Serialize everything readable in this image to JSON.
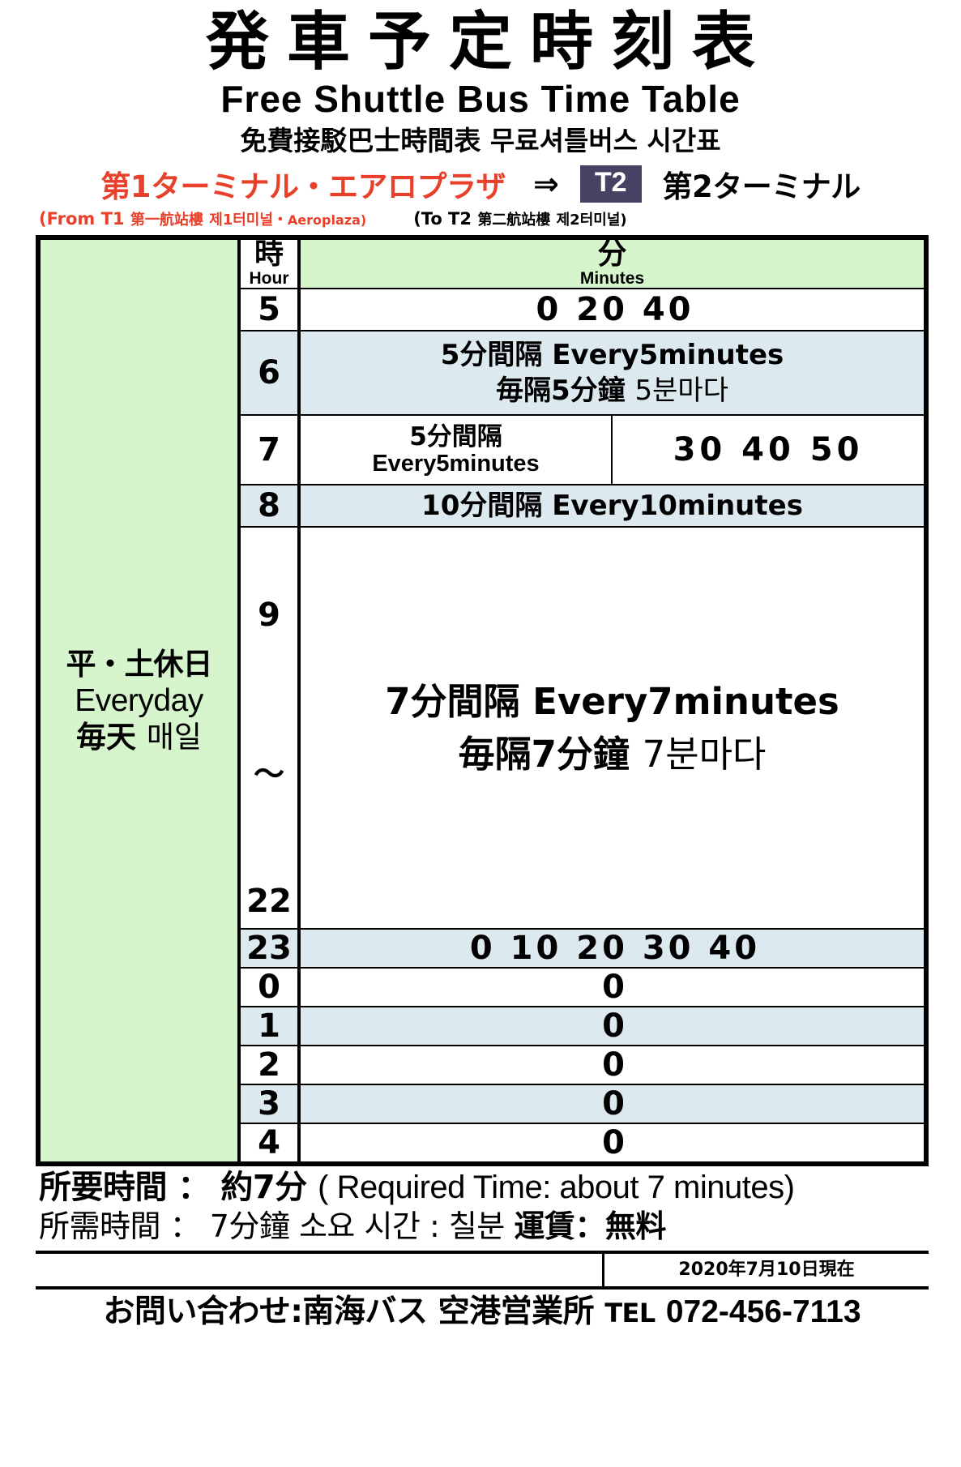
{
  "header": {
    "title_jp": "発車予定時刻表",
    "title_en": "Free Shuttle Bus Time Table",
    "title_zh_ko": "免費接駁巴士時間表 무료셔틀버스 시간표"
  },
  "route": {
    "from_jp": "第1ターミナル・エアロプラザ",
    "arrow": "⇒",
    "badge": "T2",
    "to_jp": "第2ターミナル",
    "from_sub": "(From T1",
    "from_sub_zh": "第一航站樓",
    "from_sub_ko": "제1터미널",
    "from_sub_dot": "・",
    "from_sub_en": "Aeroplaza)",
    "to_sub": "(To T2",
    "to_sub_zh": "第二航站樓",
    "to_sub_ko": "제2터미널)"
  },
  "table": {
    "day_label_l1": "平・土休日",
    "day_label_l2": "Everyday",
    "day_label_l3_zh": "毎天",
    "day_label_l3_ko": "매일",
    "head_hour_jp": "時",
    "head_hour_en": "Hour",
    "head_min_jp": "分",
    "head_min_en": "Minutes",
    "rows": [
      {
        "hour": "5",
        "minutes": "0  20  40"
      },
      {
        "hour": "6",
        "freq_l1": "5分間隔  Every5minutes",
        "freq_l2_zh": "毎隔5分鐘",
        "freq_l2_ko": "5분마다"
      },
      {
        "hour": "7",
        "freq_l1": "5分間隔",
        "freq_l2": "Every5minutes",
        "extra": "30  40  50"
      },
      {
        "hour": "8",
        "freq_l1": "10分間隔  Every10minutes"
      },
      {
        "hour_from": "9",
        "hour_tilde": "〜",
        "hour_to": "22",
        "freq_l1": "7分間隔  Every7minutes",
        "freq_l2_zh": "毎隔7分鐘",
        "freq_l2_ko": "7분마다"
      },
      {
        "hour": "23",
        "minutes": "0  10  20  30  40"
      },
      {
        "hour": "0",
        "minutes": "0"
      },
      {
        "hour": "1",
        "minutes": "0"
      },
      {
        "hour": "2",
        "minutes": "0"
      },
      {
        "hour": "3",
        "minutes": "0"
      },
      {
        "hour": "4",
        "minutes": "0"
      }
    ]
  },
  "footer": {
    "req_jp_label": "所要時間 ：",
    "req_jp_value": "約7分",
    "req_en": "( Required Time: about 7 minutes)",
    "req_zh_label": "所需時間 ：",
    "req_zh_value": "7分鐘",
    "req_ko": "소요 시간 : 칠분",
    "fare": "運賃：無料",
    "as_of_date": "2020年7月10日現在",
    "contact_text": "お問い合わせ:南海バス 空港営業所",
    "contact_tel_word": "TEL",
    "contact_tel": "072-456-7113"
  },
  "colors": {
    "accent_red": "#e8402a",
    "badge_bg": "#474263",
    "day_green": "#d7f5cd",
    "row_blue": "#dce9ef"
  }
}
